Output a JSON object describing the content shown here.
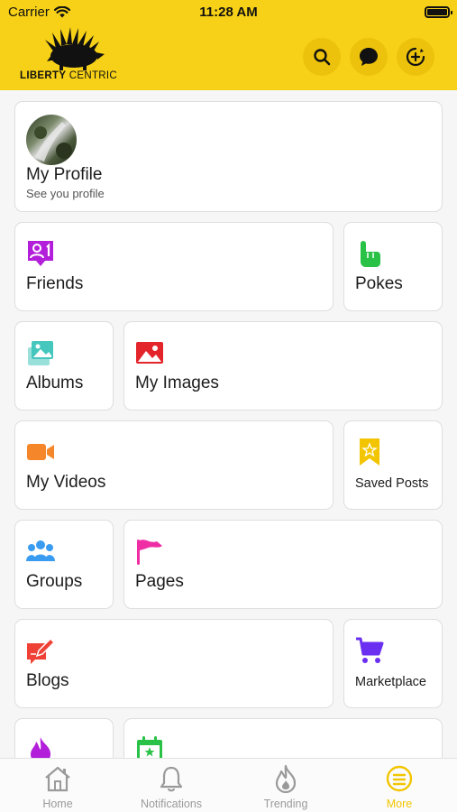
{
  "status_bar": {
    "carrier": "Carrier",
    "time": "11:28 AM"
  },
  "header": {
    "logo_text_bold": "LIBERTY",
    "logo_text_light": "CENTRIC",
    "icons": [
      "search-icon",
      "chat-icon",
      "add-circle-icon"
    ]
  },
  "profile": {
    "name": "My Profile",
    "subtitle": "See you profile"
  },
  "menu": {
    "friends": "Friends",
    "pokes": "Pokes",
    "albums": "Albums",
    "my_images": "My Images",
    "my_videos": "My Videos",
    "saved_posts": "Saved Posts",
    "groups": "Groups",
    "pages": "Pages",
    "blogs": "Blogs",
    "marketplace": "Marketplace"
  },
  "tabbar": {
    "home": "Home",
    "notifications": "Notifications",
    "trending": "Trending",
    "more": "More",
    "active": "More"
  },
  "colors": {
    "brand_yellow": "#f7d117",
    "friends": "#b21ed9",
    "pokes": "#29c146",
    "albums": "#46c7bd",
    "my_images": "#e3242b",
    "my_videos": "#f5872a",
    "saved_posts": "#f2c500",
    "groups": "#3a9cf0",
    "pages": "#ef2ea5",
    "blogs": "#ef4135",
    "marketplace": "#6a2ff0"
  }
}
